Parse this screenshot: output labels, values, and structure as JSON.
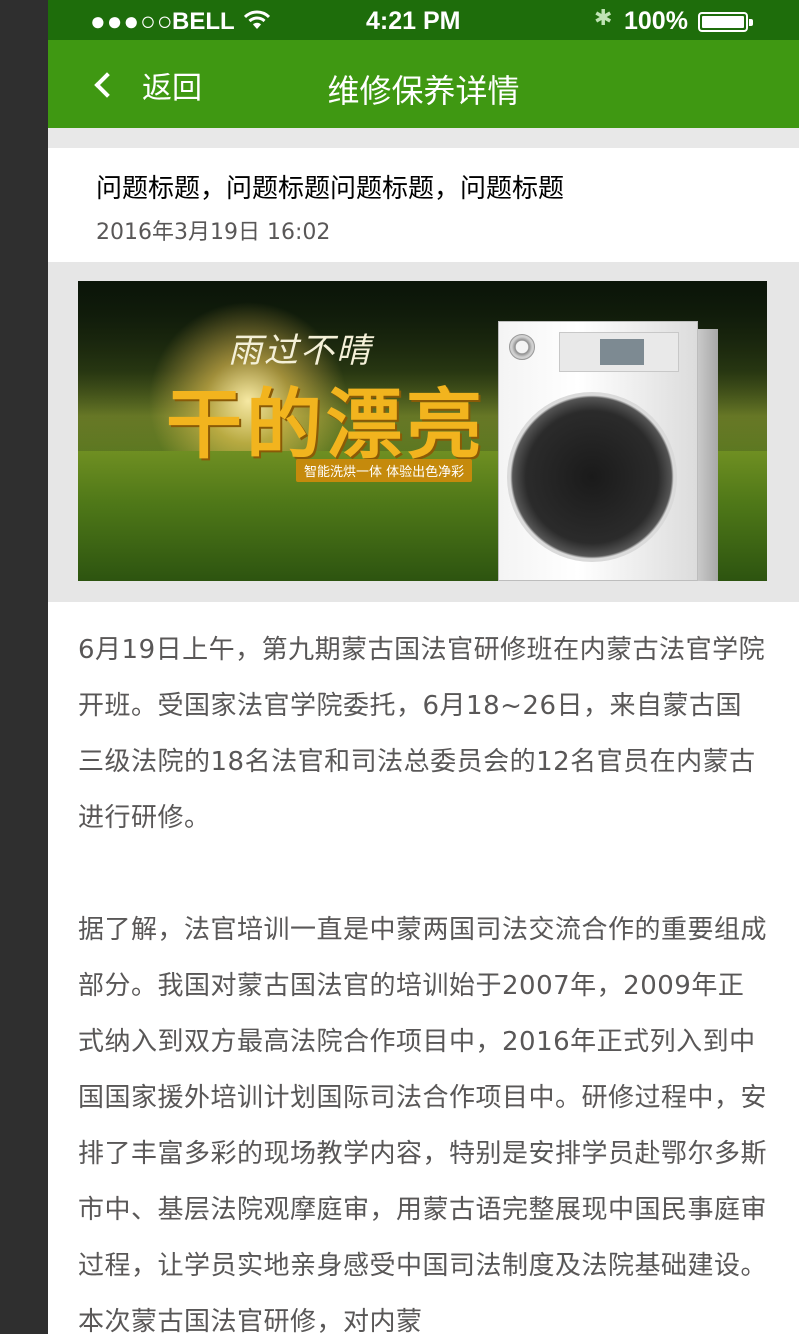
{
  "status_bar": {
    "signal": "●●●○○",
    "carrier": "BELL",
    "time": "4:21 PM",
    "bluetooth": "✱",
    "battery_percent": "100%",
    "battery_level": 1.0
  },
  "nav": {
    "back_label": "返回",
    "title": "维修保养详情"
  },
  "header": {
    "question_title": "问题标题，问题标题问题标题，问题标题",
    "date": "2016年3月19日 16:02"
  },
  "banner": {
    "slogan_top": "雨过不晴",
    "slogan_main": "干的漂亮",
    "slogan_sub": "智能洗烘一体   体验出色净彩"
  },
  "content": {
    "paragraphs": [
      "6月19日上午，第九期蒙古国法官研修班在内蒙古法官学院开班。受国家法官学院委托，6月18~26日，来自蒙古国三级法院的18名法官和司法总委员会的12名官员在内蒙古进行研修。",
      "据了解，法官培训一直是中蒙两国司法交流合作的重要组成部分。我国对蒙古国法官的培训始于2007年，2009年正式纳入到双方最高法院合作项目中，2016年正式列入到中国国家援外培训计划国际司法合作项目中。研修过程中，安排了丰富多彩的现场教学内容，特别是安排学员赴鄂尔多斯市中、基层法院观摩庭审，用蒙古语完整展现中国民事庭审过程，让学员实地亲身感受中国司法制度及法院基础建设。本次蒙古国法官研修，对内蒙"
    ]
  },
  "colors": {
    "status_bar_bg": "#1e6d0b",
    "nav_bg": "#3f9812",
    "title_text": "#000000",
    "secondary_text": "#595757",
    "spacer_bg": "#e8e8e8"
  }
}
